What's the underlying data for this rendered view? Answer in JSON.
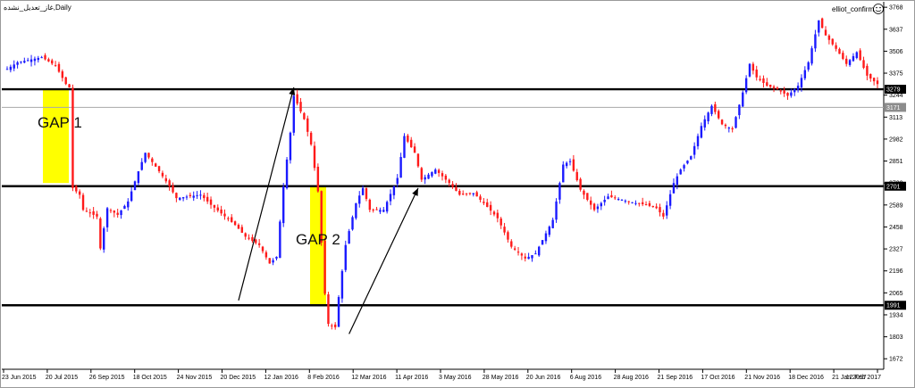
{
  "window": {
    "title": "غاز_تعديل_نشده,Daily"
  },
  "indicator": {
    "label": "elliot_confirm"
  },
  "chart_data": {
    "type": "candlestick",
    "y_ticks": [
      3768,
      3637,
      3506,
      3375,
      3244,
      3113,
      2982,
      2851,
      2720,
      2589,
      2458,
      2327,
      2196,
      2065,
      1934,
      1803,
      1672
    ],
    "ylim": [
      1620,
      3790
    ],
    "x_ticks": [
      "23 Jun 2015",
      "20 Jul 2015",
      "26 Sep 2015",
      "18 Oct 2015",
      "24 Nov 2015",
      "20 Dec 2015",
      "12 Jan 2016",
      "8 Feb 2016",
      "12 Mar 2016",
      "11 Apr 2016",
      "3 May 2016",
      "28 May 2016",
      "20 Jun 2016",
      "6 Aug 2016",
      "28 Aug 2016",
      "21 Sep 2016",
      "17 Oct 2016",
      "21 Nov 2016",
      "18 Dec 2016",
      "21 Jan 2017",
      "12 Feb 2017"
    ],
    "levels": [
      {
        "value": 3279,
        "label": "3279"
      },
      {
        "value": 2701,
        "label": "2701"
      },
      {
        "value": 1991,
        "label": "1991"
      }
    ],
    "thin_levels": [
      {
        "value": 3171,
        "label": "3171"
      }
    ],
    "gaps": [
      {
        "name": "GAP 1",
        "from_index": 0,
        "to_index": 15,
        "top": 3279,
        "bottom": 2720
      },
      {
        "name": "GAP 2",
        "from_index": 86,
        "to_index": 95,
        "top": 2701,
        "bottom": 1991
      }
    ],
    "anchors": [
      [
        0,
        3400
      ],
      [
        3,
        3440
      ],
      [
        10,
        3470
      ],
      [
        14,
        3420
      ],
      [
        17,
        3310
      ],
      [
        18,
        3290
      ],
      [
        19,
        2690
      ],
      [
        21,
        2650
      ],
      [
        22,
        2560
      ],
      [
        26,
        2520
      ],
      [
        27,
        2330
      ],
      [
        29,
        2570
      ],
      [
        32,
        2530
      ],
      [
        35,
        2610
      ],
      [
        38,
        2790
      ],
      [
        40,
        2900
      ],
      [
        44,
        2790
      ],
      [
        47,
        2700
      ],
      [
        49,
        2630
      ],
      [
        56,
        2650
      ],
      [
        59,
        2590
      ],
      [
        66,
        2470
      ],
      [
        69,
        2400
      ],
      [
        73,
        2350
      ],
      [
        76,
        2240
      ],
      [
        78,
        2280
      ],
      [
        80,
        2700
      ],
      [
        82,
        3020
      ],
      [
        83,
        3240
      ],
      [
        86,
        3100
      ],
      [
        88,
        2950
      ],
      [
        90,
        2670
      ],
      [
        92,
        2060
      ],
      [
        93,
        1880
      ],
      [
        95,
        1860
      ],
      [
        96,
        2040
      ],
      [
        98,
        2350
      ],
      [
        101,
        2600
      ],
      [
        103,
        2690
      ],
      [
        105,
        2560
      ],
      [
        109,
        2560
      ],
      [
        113,
        2750
      ],
      [
        115,
        3000
      ],
      [
        118,
        2900
      ],
      [
        120,
        2740
      ],
      [
        124,
        2800
      ],
      [
        128,
        2720
      ],
      [
        131,
        2650
      ],
      [
        135,
        2660
      ],
      [
        138,
        2600
      ],
      [
        142,
        2510
      ],
      [
        146,
        2340
      ],
      [
        150,
        2270
      ],
      [
        153,
        2300
      ],
      [
        156,
        2420
      ],
      [
        158,
        2500
      ],
      [
        161,
        2830
      ],
      [
        163,
        2850
      ],
      [
        166,
        2680
      ],
      [
        170,
        2560
      ],
      [
        174,
        2640
      ],
      [
        178,
        2620
      ],
      [
        182,
        2600
      ],
      [
        185,
        2590
      ],
      [
        188,
        2570
      ],
      [
        190,
        2520
      ],
      [
        193,
        2720
      ],
      [
        195,
        2800
      ],
      [
        198,
        2880
      ],
      [
        201,
        3060
      ],
      [
        204,
        3180
      ],
      [
        207,
        3070
      ],
      [
        210,
        3040
      ],
      [
        213,
        3260
      ],
      [
        215,
        3430
      ],
      [
        217,
        3350
      ],
      [
        220,
        3300
      ],
      [
        223,
        3280
      ],
      [
        226,
        3240
      ],
      [
        229,
        3300
      ],
      [
        232,
        3440
      ],
      [
        235,
        3690
      ],
      [
        237,
        3600
      ],
      [
        240,
        3520
      ],
      [
        243,
        3430
      ],
      [
        246,
        3500
      ],
      [
        249,
        3360
      ],
      [
        252,
        3310
      ]
    ],
    "arrows": [
      {
        "from": [
          67,
          2020
        ],
        "to": [
          83,
          3290
        ]
      },
      {
        "from": [
          99,
          1820
        ],
        "to": [
          119,
          2690
        ]
      }
    ]
  }
}
